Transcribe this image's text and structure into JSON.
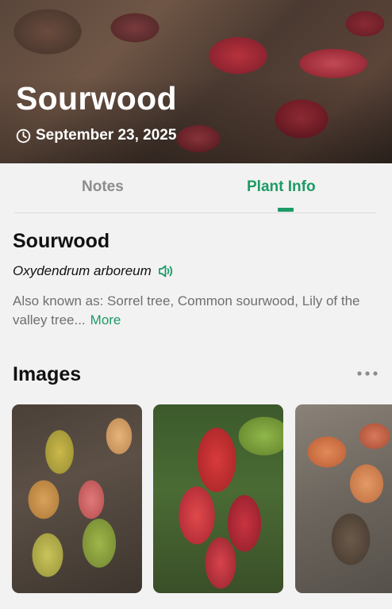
{
  "hero": {
    "title": "Sourwood",
    "date": "September 23, 2025"
  },
  "tabs": [
    {
      "label": "Notes",
      "active": false
    },
    {
      "label": "Plant Info",
      "active": true
    }
  ],
  "plant": {
    "name": "Sourwood",
    "scientific_name": "Oxydendrum arboreum",
    "also_known_as": "Also known as: Sorrel tree, Common sourwood, Lily of the valley tree...",
    "more_label": "More"
  },
  "images": {
    "title": "Images",
    "count_visible": 3
  },
  "colors": {
    "accent": "#1d9a66",
    "inactive_tab": "#8c8c8c",
    "background": "#f2f2f2"
  },
  "icons": [
    "clock-icon",
    "speaker-icon",
    "more-horizontal-icon"
  ]
}
